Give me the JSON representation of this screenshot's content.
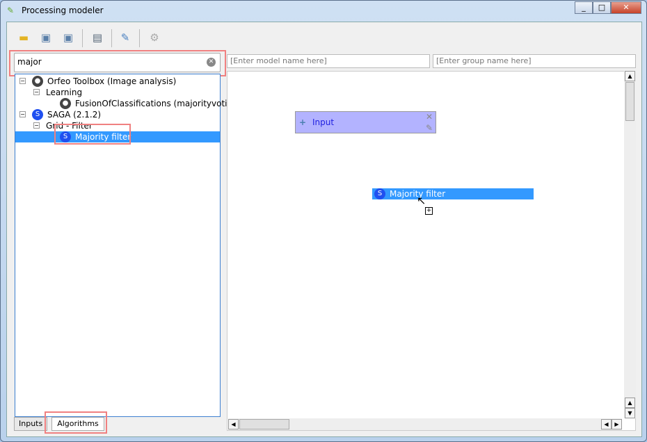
{
  "window": {
    "title": "Processing modeler"
  },
  "toolbar": {
    "icons": [
      "open-icon",
      "save-icon",
      "save-as-icon",
      "export-image-icon",
      "edit-help-icon",
      "run-icon"
    ]
  },
  "search": {
    "value": "major"
  },
  "tree": {
    "items": [
      {
        "label": "Orfeo Toolbox (Image analysis)",
        "level": 0
      },
      {
        "label": "Learning",
        "level": 1
      },
      {
        "label": "FusionOfClassifications (majorityvoti...",
        "level": 2
      },
      {
        "label": "SAGA (2.1.2)",
        "level": 0
      },
      {
        "label": "Grid - Filter",
        "level": 1
      },
      {
        "label": "Majority filter",
        "level": 2,
        "selected": true
      }
    ]
  },
  "model": {
    "name_placeholder": "[Enter model name here]",
    "group_placeholder": "[Enter group name here]"
  },
  "canvas": {
    "input_node": "Input",
    "drag_item": "Majority filter"
  },
  "tabs": {
    "inputs": "Inputs",
    "algorithms": "Algorithms"
  },
  "colors": {
    "selection": "#3399ff",
    "input_node": "#b3b3ff",
    "highlight": "#f08080"
  }
}
